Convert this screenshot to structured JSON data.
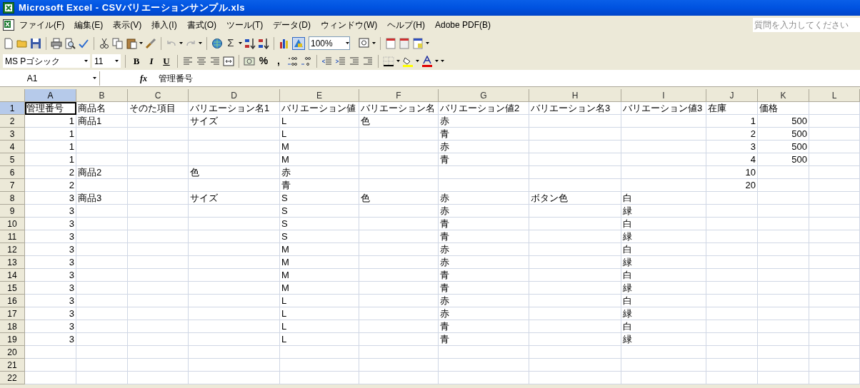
{
  "window": {
    "title": "Microsoft Excel - CSVバリエーションサンプル.xls"
  },
  "menu": [
    "ファイル(F)",
    "編集(E)",
    "表示(V)",
    "挿入(I)",
    "書式(O)",
    "ツール(T)",
    "データ(D)",
    "ウィンドウ(W)",
    "ヘルプ(H)",
    "Adobe PDF(B)"
  ],
  "help_box": {
    "placeholder": "質問を入力してください"
  },
  "standard_toolbar": {
    "sum_symbol": "Σ",
    "zoom": "100%"
  },
  "format_toolbar": {
    "font": "MS Pゴシック",
    "size": "11",
    "bold": "B",
    "italic": "I",
    "underline": "U",
    "percent": "%",
    "comma": ","
  },
  "formula_bar": {
    "name_box": "A1",
    "fx": "fx",
    "formula": "管理番号"
  },
  "sheet": {
    "columns": [
      {
        "letter": "A",
        "selected": true
      },
      {
        "letter": "B",
        "selected": false
      },
      {
        "letter": "C",
        "selected": false
      },
      {
        "letter": "D",
        "selected": false
      },
      {
        "letter": "E",
        "selected": false
      },
      {
        "letter": "F",
        "selected": false
      },
      {
        "letter": "G",
        "selected": false
      },
      {
        "letter": "H",
        "selected": false
      },
      {
        "letter": "I",
        "selected": false
      },
      {
        "letter": "J",
        "selected": false
      },
      {
        "letter": "K",
        "selected": false
      },
      {
        "letter": "L",
        "selected": false
      }
    ],
    "rows": [
      {
        "number": "1",
        "selected": true,
        "cells": {
          "A": {
            "text": "管理番号"
          },
          "B": {
            "text": "商品名"
          },
          "C": {
            "text": "そのた項目"
          },
          "D": {
            "text": "バリエーション名1"
          },
          "E": {
            "text": "バリエーション値"
          },
          "F": {
            "text": "バリエーション名"
          },
          "G": {
            "text": "バリエーション値2"
          },
          "H": {
            "text": "バリエーション名3"
          },
          "I": {
            "text": "バリエーション値3"
          },
          "J": {
            "text": "在庫"
          },
          "K": {
            "text": "価格"
          }
        }
      },
      {
        "number": "2",
        "selected": false,
        "cells": {
          "A": {
            "number": "1"
          },
          "B": {
            "text": "商品1"
          },
          "D": {
            "text": "サイズ"
          },
          "E": {
            "text": "L"
          },
          "F": {
            "text": "色"
          },
          "G": {
            "text": "赤"
          },
          "J": {
            "number": "1"
          },
          "K": {
            "number": "500"
          }
        }
      },
      {
        "number": "3",
        "selected": false,
        "cells": {
          "A": {
            "number": "1"
          },
          "E": {
            "text": "L"
          },
          "G": {
            "text": "青"
          },
          "J": {
            "number": "2"
          },
          "K": {
            "number": "500"
          }
        }
      },
      {
        "number": "4",
        "selected": false,
        "cells": {
          "A": {
            "number": "1"
          },
          "E": {
            "text": "M"
          },
          "G": {
            "text": "赤"
          },
          "J": {
            "number": "3"
          },
          "K": {
            "number": "500"
          }
        }
      },
      {
        "number": "5",
        "selected": false,
        "cells": {
          "A": {
            "number": "1"
          },
          "E": {
            "text": "M"
          },
          "G": {
            "text": "青"
          },
          "J": {
            "number": "4"
          },
          "K": {
            "number": "500"
          }
        }
      },
      {
        "number": "6",
        "selected": false,
        "cells": {
          "A": {
            "number": "2"
          },
          "B": {
            "text": "商品2"
          },
          "D": {
            "text": "色"
          },
          "E": {
            "text": "赤"
          },
          "J": {
            "number": "10"
          }
        }
      },
      {
        "number": "7",
        "selected": false,
        "cells": {
          "A": {
            "number": "2"
          },
          "E": {
            "text": "青"
          },
          "J": {
            "number": "20"
          }
        }
      },
      {
        "number": "8",
        "selected": false,
        "cells": {
          "A": {
            "number": "3"
          },
          "B": {
            "text": "商品3"
          },
          "D": {
            "text": "サイズ"
          },
          "E": {
            "text": "S"
          },
          "F": {
            "text": "色"
          },
          "G": {
            "text": "赤"
          },
          "H": {
            "text": "ボタン色"
          },
          "I": {
            "text": "白"
          }
        }
      },
      {
        "number": "9",
        "selected": false,
        "cells": {
          "A": {
            "number": "3"
          },
          "E": {
            "text": "S"
          },
          "G": {
            "text": "赤"
          },
          "I": {
            "text": "緑"
          }
        }
      },
      {
        "number": "10",
        "selected": false,
        "cells": {
          "A": {
            "number": "3"
          },
          "E": {
            "text": "S"
          },
          "G": {
            "text": "青"
          },
          "I": {
            "text": "白"
          }
        }
      },
      {
        "number": "11",
        "selected": false,
        "cells": {
          "A": {
            "number": "3"
          },
          "E": {
            "text": "S"
          },
          "G": {
            "text": "青"
          },
          "I": {
            "text": "緑"
          }
        }
      },
      {
        "number": "12",
        "selected": false,
        "cells": {
          "A": {
            "number": "3"
          },
          "E": {
            "text": "M"
          },
          "G": {
            "text": "赤"
          },
          "I": {
            "text": "白"
          }
        }
      },
      {
        "number": "13",
        "selected": false,
        "cells": {
          "A": {
            "number": "3"
          },
          "E": {
            "text": "M"
          },
          "G": {
            "text": "赤"
          },
          "I": {
            "text": "緑"
          }
        }
      },
      {
        "number": "14",
        "selected": false,
        "cells": {
          "A": {
            "number": "3"
          },
          "E": {
            "text": "M"
          },
          "G": {
            "text": "青"
          },
          "I": {
            "text": "白"
          }
        }
      },
      {
        "number": "15",
        "selected": false,
        "cells": {
          "A": {
            "number": "3"
          },
          "E": {
            "text": "M"
          },
          "G": {
            "text": "青"
          },
          "I": {
            "text": "緑"
          }
        }
      },
      {
        "number": "16",
        "selected": false,
        "cells": {
          "A": {
            "number": "3"
          },
          "E": {
            "text": "L"
          },
          "G": {
            "text": "赤"
          },
          "I": {
            "text": "白"
          }
        }
      },
      {
        "number": "17",
        "selected": false,
        "cells": {
          "A": {
            "number": "3"
          },
          "E": {
            "text": "L"
          },
          "G": {
            "text": "赤"
          },
          "I": {
            "text": "緑"
          }
        }
      },
      {
        "number": "18",
        "selected": false,
        "cells": {
          "A": {
            "number": "3"
          },
          "E": {
            "text": "L"
          },
          "G": {
            "text": "青"
          },
          "I": {
            "text": "白"
          }
        }
      },
      {
        "number": "19",
        "selected": false,
        "cells": {
          "A": {
            "number": "3"
          },
          "E": {
            "text": "L"
          },
          "G": {
            "text": "青"
          },
          "I": {
            "text": "緑"
          }
        }
      },
      {
        "number": "20",
        "selected": false,
        "cells": {}
      },
      {
        "number": "21",
        "selected": false,
        "cells": {}
      },
      {
        "number": "22",
        "selected": false,
        "cells": {}
      }
    ]
  }
}
